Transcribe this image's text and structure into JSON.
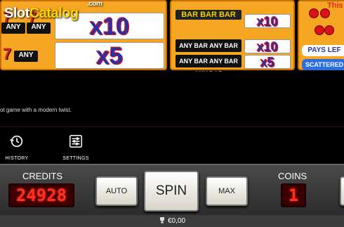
{
  "watermark": {
    "slot": "Slot",
    "catalog": "Catalog",
    "com": ".com"
  },
  "corner_link": "This",
  "paytable": {
    "left_rows": [
      {
        "symbols": [
          "ANY",
          "ANY"
        ],
        "prize": "x10"
      },
      {
        "symbols": [
          "ANY"
        ],
        "prize": "x5"
      }
    ],
    "mid_rows": [
      {
        "symbol": "BAR BAR BAR",
        "prize": "x10"
      },
      {
        "symbol": "ANY BAR ANY BAR ANY BAR",
        "prize": "x10"
      },
      {
        "symbol": "ANY BAR ANY BAR ANY BAR",
        "prize": "x5"
      }
    ],
    "right": {
      "pays_label": "PAYS LEF",
      "scatter_label": "SCATTERED"
    }
  },
  "description": "ot game with a modern twist.",
  "nav": {
    "history": "HISTORY",
    "settings": "SETTINGS"
  },
  "console": {
    "credits_label": "CREDITS",
    "credits_value": "24928",
    "coins_label": "COINS",
    "coins_value": "1",
    "auto_label": "AUTO",
    "spin_label": "SPIN",
    "max_label": "MAX"
  },
  "status": {
    "win_amount": "€0,00"
  },
  "colors": {
    "panel": "#f5a623",
    "led": "#ff3020",
    "accent": "#ffd200"
  }
}
